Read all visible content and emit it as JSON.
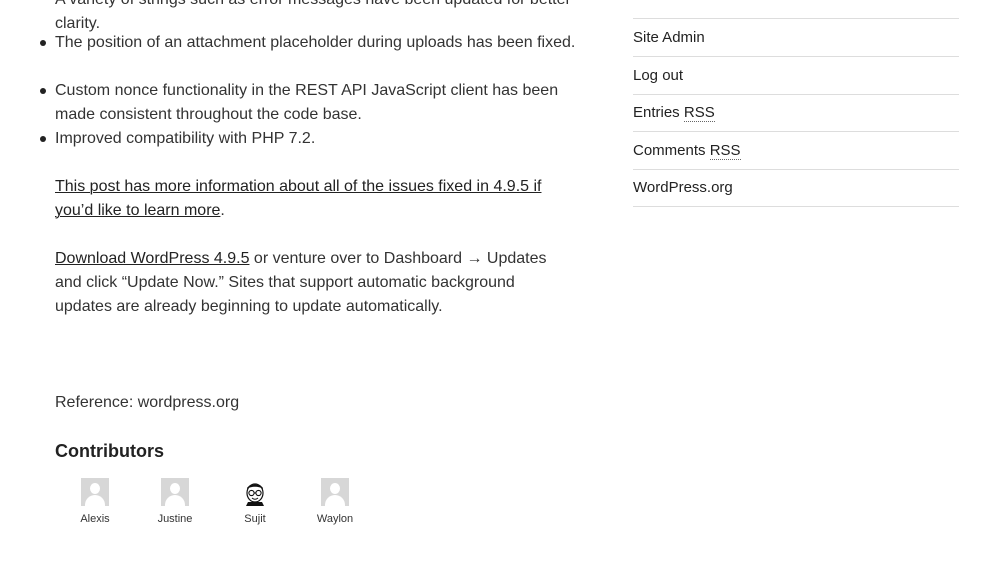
{
  "content": {
    "bullets": [
      "A variety of strings such as error messages have been updated for better clarity.",
      "The position of an attachment placeholder during uploads has been fixed.",
      "Custom nonce functionality in the REST API JavaScript client has been made consistent throughout the code base.",
      "Improved compatibility with PHP 7.2."
    ],
    "post_link_text": "This post has more information about all of the issues fixed in 4.9.5 if you’d like to learn more",
    "post_link_period": ".",
    "download_link_text": "Download WordPress 4.9.5",
    "download_rest": " or venture over to Dashboard → Updates and click “Update Now.” Sites that support automatic background updates are already beginning to update automatically.",
    "reference": "Reference: wordpress.org"
  },
  "contributors": {
    "heading": "Contributors",
    "people": [
      {
        "name": "Alexis",
        "avatar": "default-avatar-icon"
      },
      {
        "name": "Justine",
        "avatar": "default-avatar-icon"
      },
      {
        "name": "Sujit",
        "avatar": "cartoon-avatar-icon"
      },
      {
        "name": "Waylon",
        "avatar": "default-avatar-icon"
      }
    ]
  },
  "sidebar": {
    "meta_links": {
      "site_admin": "Site Admin",
      "log_out": "Log out",
      "entries_prefix": "Entries ",
      "entries_abbr": "RSS",
      "comments_prefix": "Comments ",
      "comments_abbr": "RSS",
      "wordpress_org": "WordPress.org"
    }
  },
  "colors": {
    "text": "#333333",
    "link": "#222222",
    "rule": "#dddddd",
    "avatar_placeholder": "#d7d7d7"
  }
}
